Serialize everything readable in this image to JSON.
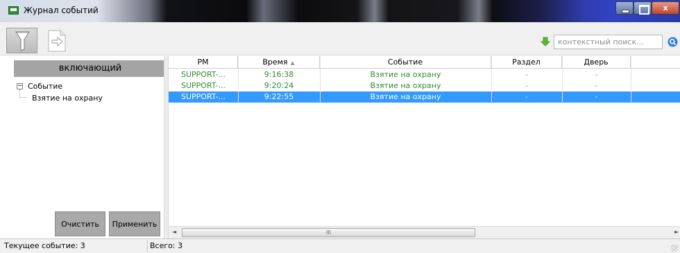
{
  "window": {
    "title": "Журнал событий",
    "icon": "event-log-app-icon",
    "controls": [
      "minimize-icon",
      "maximize-icon",
      "close-icon"
    ],
    "close_label": "x"
  },
  "toolbar": {
    "filter_icon": "funnel-icon",
    "document_icon": "document-arrow-icon",
    "search": {
      "placeholder": "контекстный поиск...",
      "value": "",
      "arrow_icon": "green-down-arrow-icon",
      "button_icon": "search-icon"
    }
  },
  "filter_panel": {
    "mode_label": "включающий",
    "tree": {
      "root": {
        "toggle": "⊟",
        "label": "Событие"
      },
      "children": [
        {
          "label": "Взятие на охрану"
        }
      ]
    },
    "buttons": {
      "clear": "Очистить",
      "apply": "Применить"
    }
  },
  "grid": {
    "columns": [
      {
        "key": "pm",
        "label": "РМ",
        "sort": ""
      },
      {
        "key": "time",
        "label": "Время",
        "sort": "▲"
      },
      {
        "key": "event",
        "label": "Событие",
        "sort": ""
      },
      {
        "key": "section",
        "label": "Раздел",
        "sort": ""
      },
      {
        "key": "door",
        "label": "Дверь",
        "sort": ""
      }
    ],
    "rows": [
      {
        "pm": "SUPPORT-...",
        "time": "9:16:38",
        "event": "Взятие на охрану",
        "section": "-",
        "door": "-",
        "selected": false
      },
      {
        "pm": "SUPPORT-...",
        "time": "9:20:24",
        "event": "Взятие на охрану",
        "section": "-",
        "door": "-",
        "selected": false
      },
      {
        "pm": "SUPPORT-...",
        "time": "9:22:55",
        "event": "Взятие на охрану",
        "section": "-",
        "door": "-",
        "selected": true
      }
    ],
    "row_text_color": "#2e8b2e",
    "selection_color": "#3399ff",
    "scrollbar": {
      "left_arrow": "◄",
      "right_arrow": "►",
      "thumb_grip": "III"
    }
  },
  "status": {
    "current_event": "Текущее событие: 3",
    "total": "Всего: 3"
  }
}
